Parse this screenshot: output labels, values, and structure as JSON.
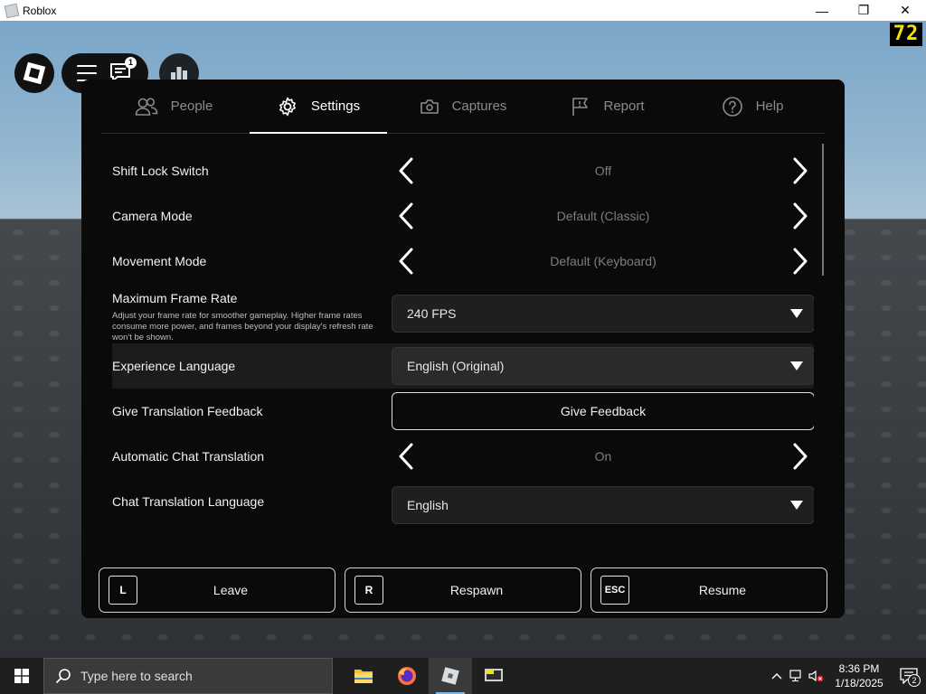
{
  "window": {
    "title": "Roblox",
    "minimize": "—",
    "maximize": "❐",
    "close": "✕"
  },
  "hud": {
    "fps": "72",
    "chat_badge": "1"
  },
  "tabs": [
    {
      "label": "People",
      "icon": "people-icon"
    },
    {
      "label": "Settings",
      "icon": "gear-icon",
      "active": true
    },
    {
      "label": "Captures",
      "icon": "camera-icon"
    },
    {
      "label": "Report",
      "icon": "flag-icon"
    },
    {
      "label": "Help",
      "icon": "help-icon"
    }
  ],
  "settings": {
    "shift_lock": {
      "label": "Shift Lock Switch",
      "value": "Off"
    },
    "camera_mode": {
      "label": "Camera Mode",
      "value": "Default (Classic)"
    },
    "movement_mode": {
      "label": "Movement Mode",
      "value": "Default (Keyboard)"
    },
    "max_frame_rate": {
      "label": "Maximum Frame Rate",
      "description": "Adjust your frame rate for smoother gameplay. Higher frame rates consume more power, and frames beyond your display's refresh rate won't be shown.",
      "value": "240 FPS"
    },
    "experience_language": {
      "label": "Experience Language",
      "value": "English (Original)"
    },
    "translation_feedback": {
      "label": "Give Translation Feedback",
      "button": "Give Feedback"
    },
    "auto_chat_translation": {
      "label": "Automatic Chat Translation",
      "value": "On"
    },
    "chat_translation_language": {
      "label": "Chat Translation Language",
      "value": "English"
    }
  },
  "actions": [
    {
      "key": "L",
      "label": "Leave"
    },
    {
      "key": "R",
      "label": "Respawn"
    },
    {
      "key": "ESC",
      "label": "Resume"
    }
  ],
  "taskbar": {
    "search_placeholder": "Type here to search",
    "time": "8:36 PM",
    "date": "1/18/2025",
    "notification_count": "2"
  }
}
